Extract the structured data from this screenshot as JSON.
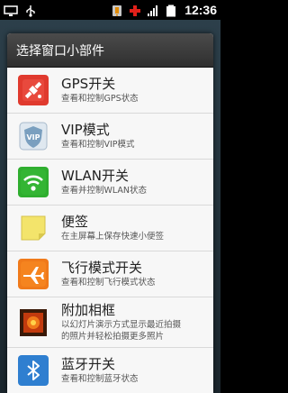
{
  "status_bar": {
    "time": "12:36",
    "left_icons": [
      "screen-icon",
      "usb-icon"
    ],
    "right_icons": [
      "sim-alert-icon",
      "medical-cross-icon",
      "signal-icon",
      "battery-icon"
    ]
  },
  "dialog": {
    "title": "选择窗口小部件",
    "items": [
      {
        "title": "GPS开关",
        "subtitle": "查看和控制GPS状态",
        "icon": "gps-satellite-icon",
        "color": "#e03a2e"
      },
      {
        "title": "VIP模式",
        "subtitle": "查看和控制VIP模式",
        "icon": "vip-shield-icon",
        "color": "#7a9fbf"
      },
      {
        "title": "WLAN开关",
        "subtitle": "查看并控制WLAN状态",
        "icon": "wifi-icon",
        "color": "#2fae2f"
      },
      {
        "title": "便签",
        "subtitle": "在主屏幕上保存快速小便签",
        "icon": "sticky-note-icon",
        "color": "#f3e46b"
      },
      {
        "title": "飞行模式开关",
        "subtitle": "查看和控制飞行模式状态",
        "icon": "airplane-icon",
        "color": "#f07a1a"
      },
      {
        "title": "附加相框",
        "subtitle": "以幻灯片演示方式显示最近拍摄的照片并轻松拍摄更多照片",
        "subtitle_line1": "以幻灯片演示方式显示最近拍摄",
        "subtitle_line2": "的照片并轻松拍摄更多照片",
        "icon": "photo-frame-icon",
        "color": "#5a2a10"
      },
      {
        "title": "蓝牙开关",
        "subtitle": "查看和控制蓝牙状态",
        "icon": "bluetooth-icon",
        "color": "#2f7fd0"
      }
    ]
  }
}
